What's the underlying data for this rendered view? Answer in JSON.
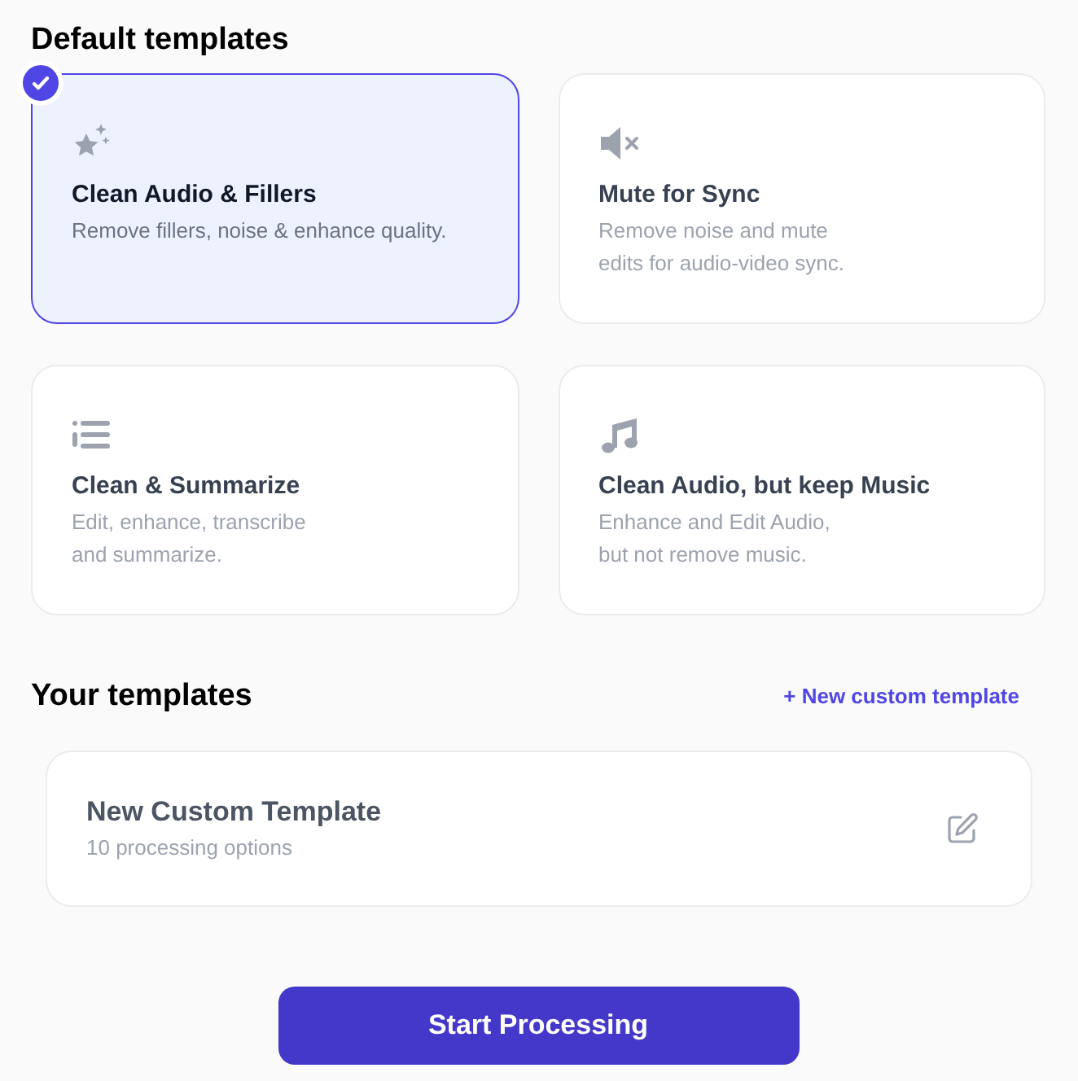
{
  "default_section": {
    "title": "Default templates"
  },
  "templates": [
    {
      "title": "Clean Audio & Fillers",
      "description": [
        "Remove fillers, noise & enhance quality."
      ],
      "selected": true
    },
    {
      "title": "Mute for Sync",
      "description": [
        "Remove noise and mute",
        "edits for audio-video sync."
      ],
      "selected": false
    },
    {
      "title": "Clean & Summarize",
      "description": [
        "Edit, enhance, transcribe",
        "and summarize."
      ],
      "selected": false
    },
    {
      "title": "Clean Audio, but keep Music",
      "description": [
        "Enhance and Edit Audio,",
        "but not remove music."
      ],
      "selected": false
    }
  ],
  "your_section": {
    "title": "Your templates",
    "new_link": "+ New custom template"
  },
  "custom_templates": [
    {
      "title": "New Custom Template",
      "subtitle": "10 processing options"
    }
  ],
  "start_button": "Start Processing"
}
